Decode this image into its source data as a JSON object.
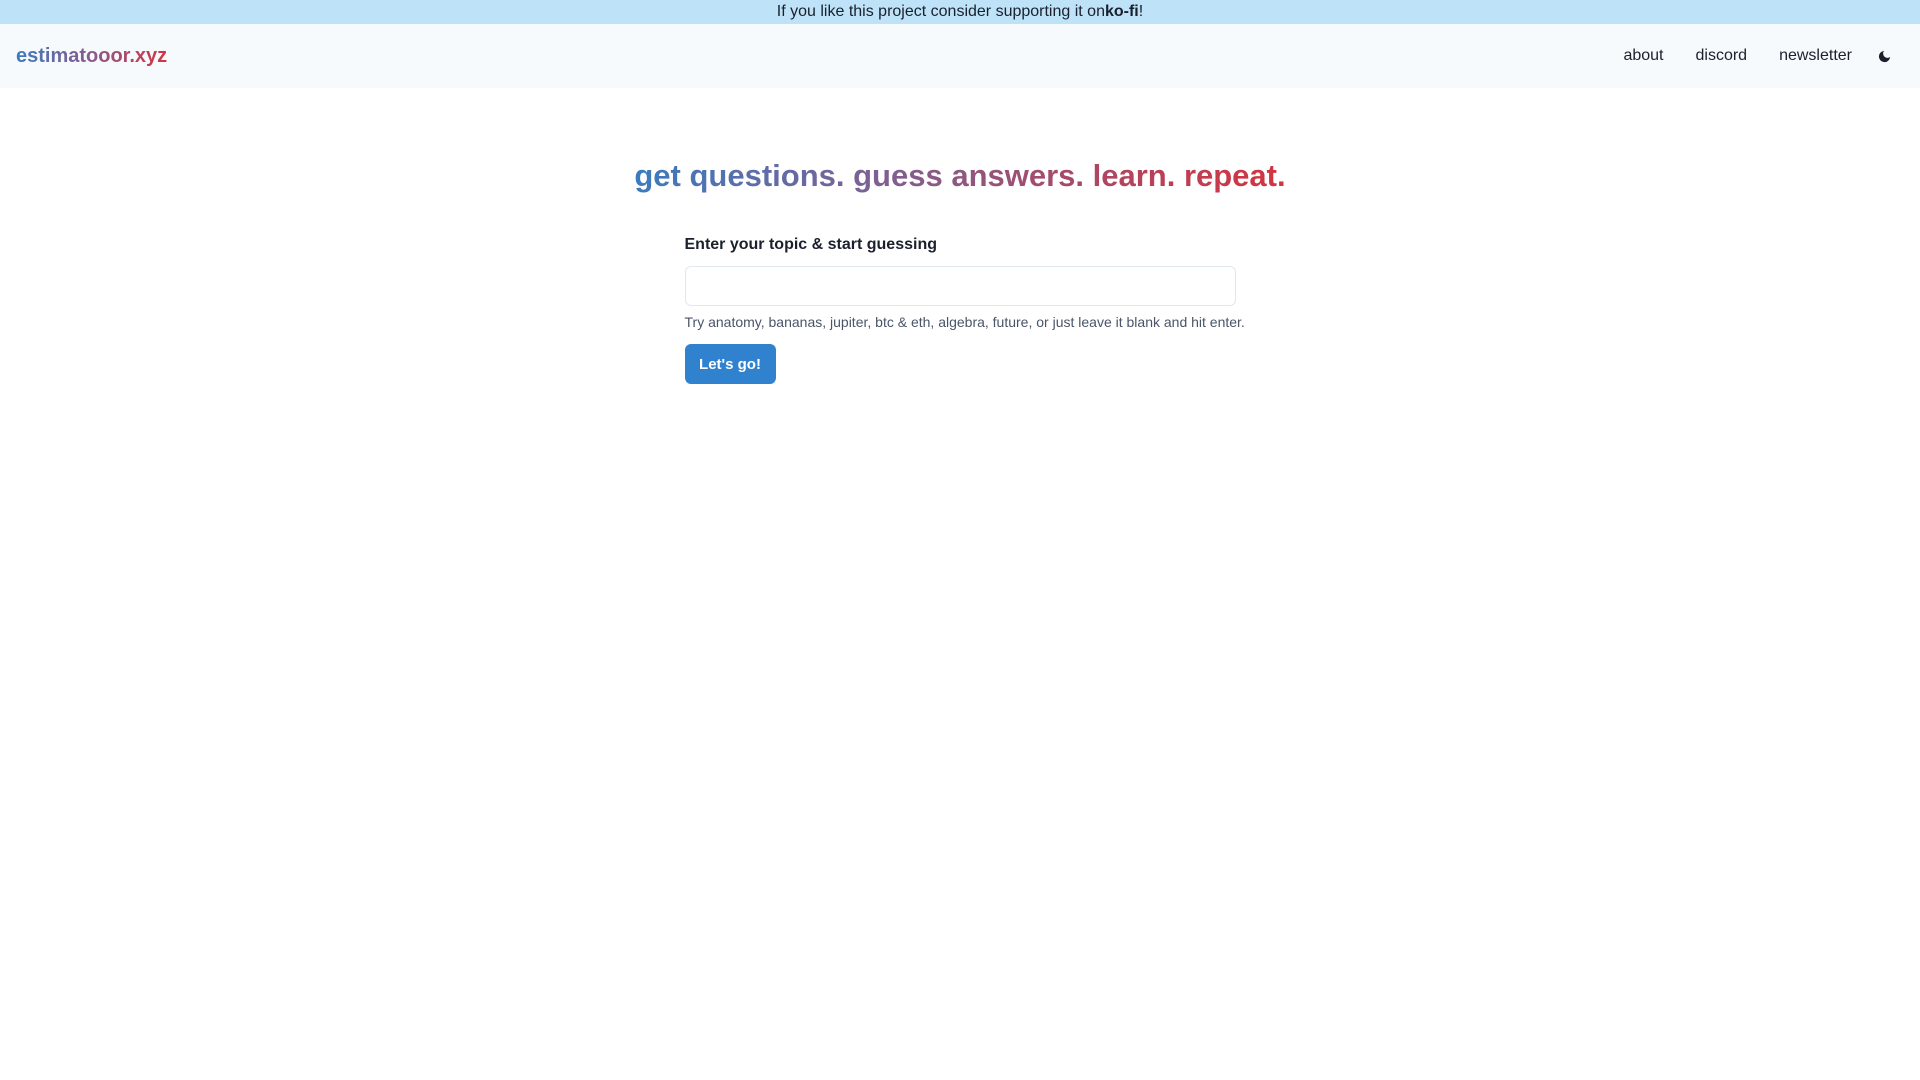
{
  "banner": {
    "text_before": "If you like this project consider supporting it on ",
    "link_label": "ko-fi",
    "text_after": "!"
  },
  "navbar": {
    "logo": "estimatooor.xyz",
    "links": [
      {
        "label": "about"
      },
      {
        "label": "discord"
      },
      {
        "label": "newsletter"
      }
    ],
    "theme_toggle_icon": "moon-icon"
  },
  "main": {
    "headline": "get questions. guess answers. learn. repeat.",
    "form_label": "Enter your topic & start guessing",
    "input_value": "",
    "input_placeholder": "",
    "helper_text": "Try anatomy, bananas, jupiter, btc & eth, algebra, future, or just leave it blank and hit enter.",
    "submit_label": "Let's go!"
  },
  "colors": {
    "banner_bg": "#bee3f8",
    "navbar_bg": "#f7fafc",
    "gradient_start": "#3b7bbf",
    "gradient_end": "#d4333f",
    "button_bg": "#3182ce"
  }
}
